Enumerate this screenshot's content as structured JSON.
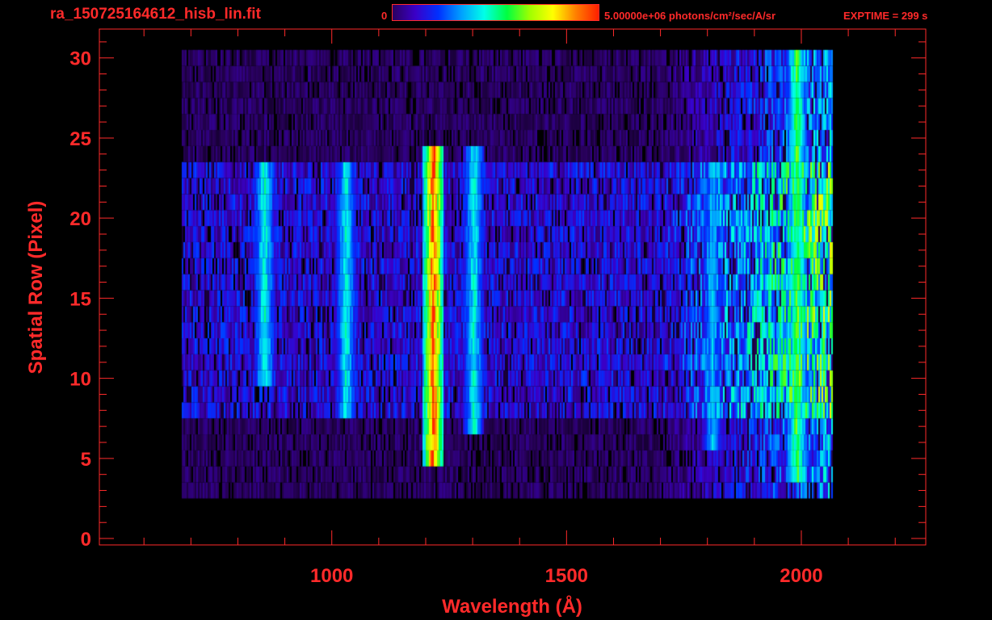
{
  "header": {
    "filename": "ra_150725164612_hisb_lin.fit",
    "colorbar_min_label": "0",
    "colorbar_max_label": "5.00000e+06 photons/cm²/sec/A/sr",
    "exptime": "EXPTIME = 299 s"
  },
  "colors": {
    "axis": "#ff2a2a",
    "background": "#000000",
    "colormap": [
      "#000000",
      "#2a0060",
      "#3a00c8",
      "#0030ff",
      "#00a0ff",
      "#00ffe8",
      "#00ff40",
      "#a0ff00",
      "#ffff00",
      "#ff8000",
      "#ff2000"
    ]
  },
  "chart_data": {
    "type": "heatmap",
    "title": "ra_150725164612_hisb_lin.fit",
    "xlabel": "Wavelength (Å)",
    "ylabel": "Spatial Row (Pixel)",
    "xlim": [
      505,
      2265
    ],
    "ylim": [
      -0.4,
      31.8
    ],
    "x_ticks": [
      1000,
      1500,
      2000
    ],
    "y_ticks": [
      0,
      5,
      10,
      15,
      20,
      25,
      30
    ],
    "colorbar": {
      "min": 0,
      "max": 5000000,
      "units": "photons/cm²/sec/A/sr"
    },
    "signal_extent": {
      "x_min": 680,
      "x_max": 2065,
      "y_min": 3,
      "y_max": 30
    },
    "bright_slit_rows": [
      8,
      23
    ],
    "emission_features": [
      {
        "wavelength": 856,
        "rows": [
          10,
          23
        ],
        "level": 0.52
      },
      {
        "wavelength": 1030,
        "rows": [
          8,
          23
        ],
        "level": 0.5
      },
      {
        "wavelength": 1216,
        "rows": [
          5,
          24
        ],
        "level": 0.95
      },
      {
        "wavelength": 1302,
        "rows": [
          7,
          24
        ],
        "level": 0.5
      },
      {
        "wavelength": 1810,
        "rows": [
          6,
          23
        ],
        "level": 0.42
      },
      {
        "wavelength": 1990,
        "rows": [
          4,
          30
        ],
        "level": 0.62
      }
    ]
  }
}
